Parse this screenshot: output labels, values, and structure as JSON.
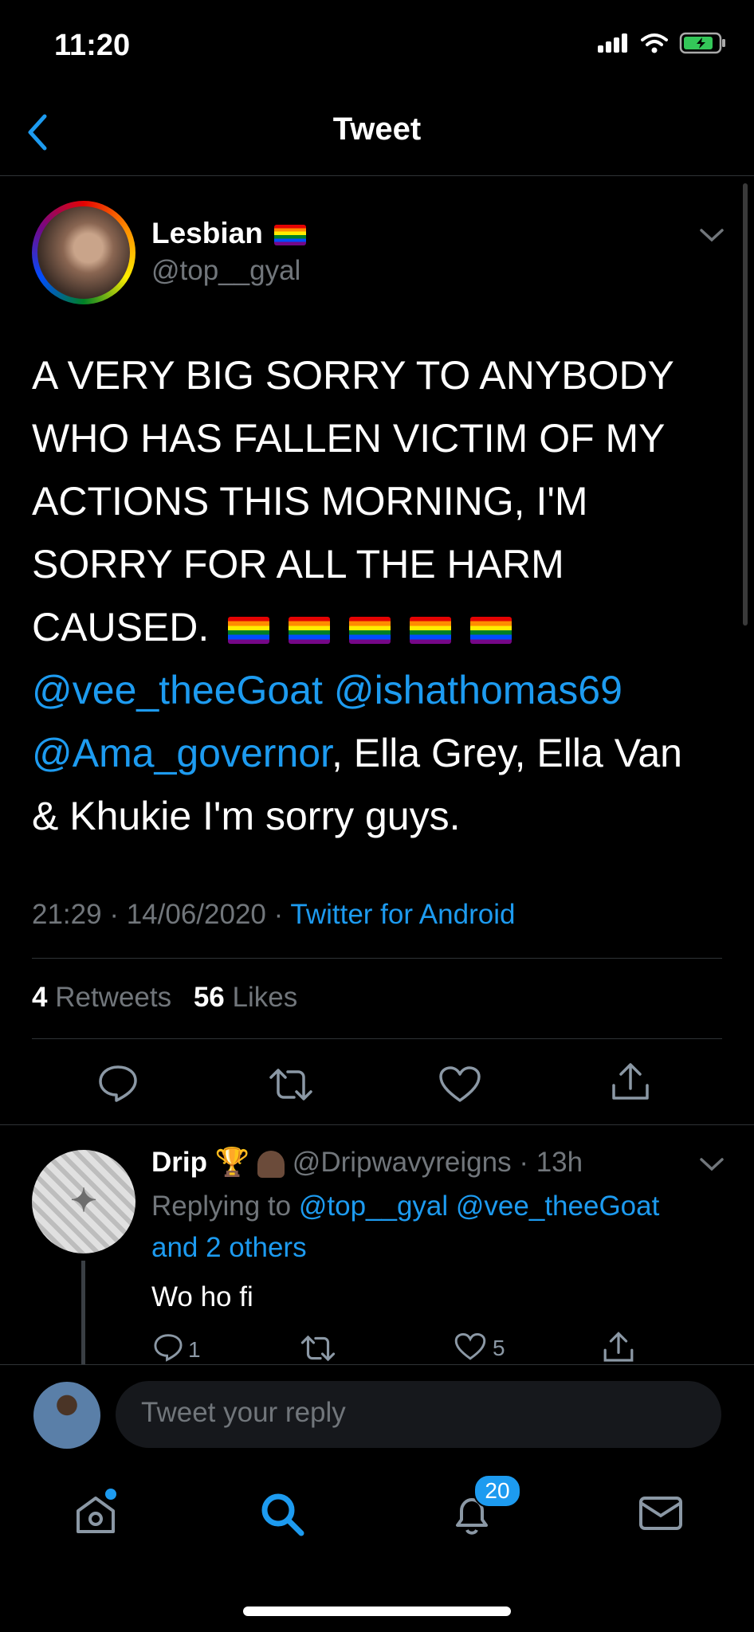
{
  "status_bar": {
    "time": "11:20"
  },
  "header": {
    "title": "Tweet"
  },
  "tweet": {
    "author_name": "Lesbian",
    "author_handle": "@top__gyal",
    "text_line1": "A VERY BIG SORRY TO ANYBODY",
    "text_line2": "WHO HAS FALLEN VICTIM OF MY",
    "text_line3": "ACTIONS THIS MORNING, I'M",
    "text_line4": "SORRY FOR ALL THE HARM",
    "text_line5": "CAUSED.",
    "mention1": "@vee_theeGoat",
    "mention2": "@ishathomas69",
    "mention3": "@Ama_governor",
    "text_after_mentions": ", Ella Grey, Ella Van",
    "text_last_line": "& Khukie I'm sorry guys.",
    "time": "21:29",
    "date": "14/06/2020",
    "source": "Twitter for Android",
    "retweets_count": "4",
    "retweets_label": "Retweets",
    "likes_count": "56",
    "likes_label": "Likes"
  },
  "reply": {
    "author_name": "Drip",
    "author_handle": "@Dripwavyreigns",
    "age": "13h",
    "replying_to_label": "Replying to",
    "replying_to_1": "@top__gyal",
    "replying_to_2": "@vee_theeGoat",
    "replying_to_others": "and 2 others",
    "text": "Wo ho fi",
    "reply_count": "1",
    "like_count": "5"
  },
  "composer": {
    "placeholder": "Tweet your reply"
  },
  "tabbar": {
    "notifications_badge": "20"
  },
  "colors": {
    "accent": "#1d9bf0",
    "background": "#000000",
    "muted": "#71767b"
  }
}
